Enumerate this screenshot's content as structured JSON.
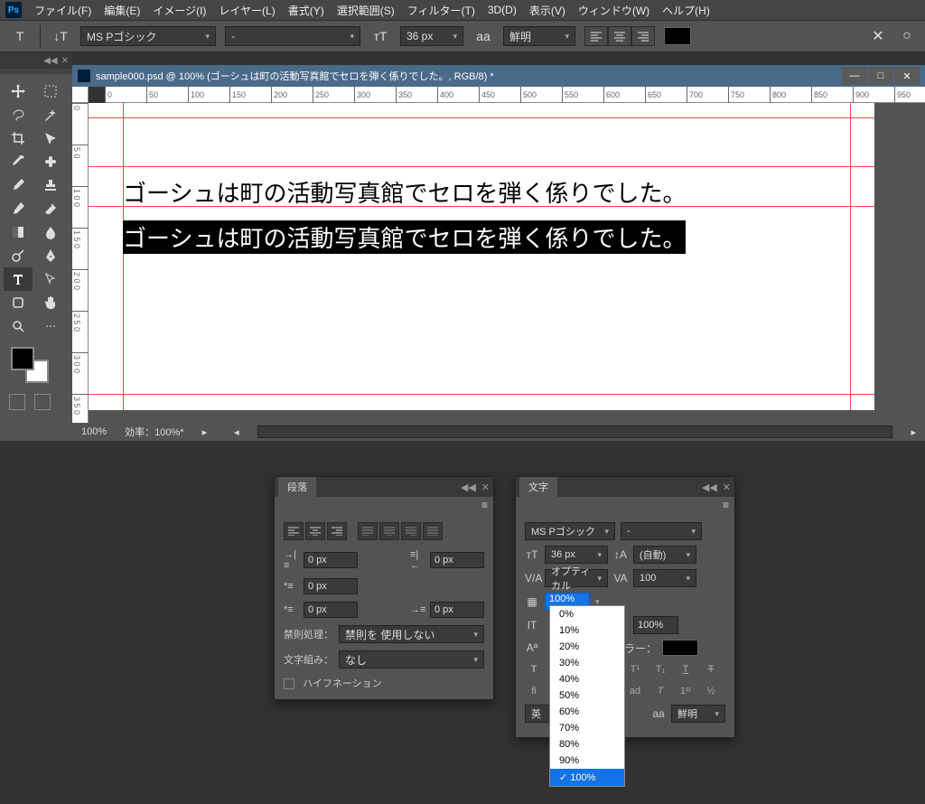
{
  "menubar": {
    "items": [
      "ファイル(F)",
      "編集(E)",
      "イメージ(I)",
      "レイヤー(L)",
      "書式(Y)",
      "選択範囲(S)",
      "フィルター(T)",
      "3D(D)",
      "表示(V)",
      "ウィンドウ(W)",
      "ヘルプ(H)"
    ]
  },
  "options": {
    "font": "MS Pゴシック",
    "weight": "-",
    "size": "36 px",
    "aa": "鮮明",
    "aa_label": "aa"
  },
  "document": {
    "title": "sample000.psd @ 100% (ゴーシュは町の活動写真館でセロを弾く係りでした。, RGB/8) *",
    "line1": "ゴーシュは町の活動写真館でセロを弾く係りでした。",
    "line2": "ゴーシュは町の活動写真館でセロを弾く係りでした。",
    "zoom": "100%",
    "efficiency": "効率：100%*",
    "ruler_h": [
      "0",
      "50",
      "100",
      "150",
      "200",
      "250",
      "300",
      "350",
      "400",
      "450",
      "500",
      "550",
      "600",
      "650",
      "700",
      "750",
      "800",
      "850",
      "900",
      "950"
    ],
    "ruler_v": [
      "0",
      "5 0",
      "1 0 0",
      "1 5 0",
      "2 0 0",
      "2 5 0",
      "3 0 0",
      "3 5 0"
    ]
  },
  "paragraph": {
    "title": "段落",
    "indent_left": "0 px",
    "indent_right": "0 px",
    "indent_first": "0 px",
    "space_before": "0 px",
    "space_after": "0 px",
    "kinsoku_label": "禁則処理：",
    "kinsoku_value": "禁則を 使用しない",
    "mojikumi_label": "文字組み：",
    "mojikumi_value": "なし",
    "hyphen": "ハイフネーション"
  },
  "character": {
    "title": "文字",
    "font": "MS Pゴシック",
    "weight": "-",
    "size": "36 px",
    "leading": "(自動)",
    "kerning": "オプティカル",
    "tracking": "100",
    "scale_h": "100%",
    "baseline": "100%",
    "color_label": "カラー：",
    "lang": "英",
    "aa_label": "aa",
    "aa": "鮮明"
  },
  "dropdown_options": [
    "0%",
    "10%",
    "20%",
    "30%",
    "40%",
    "50%",
    "60%",
    "70%",
    "80%",
    "90%",
    "100%"
  ]
}
